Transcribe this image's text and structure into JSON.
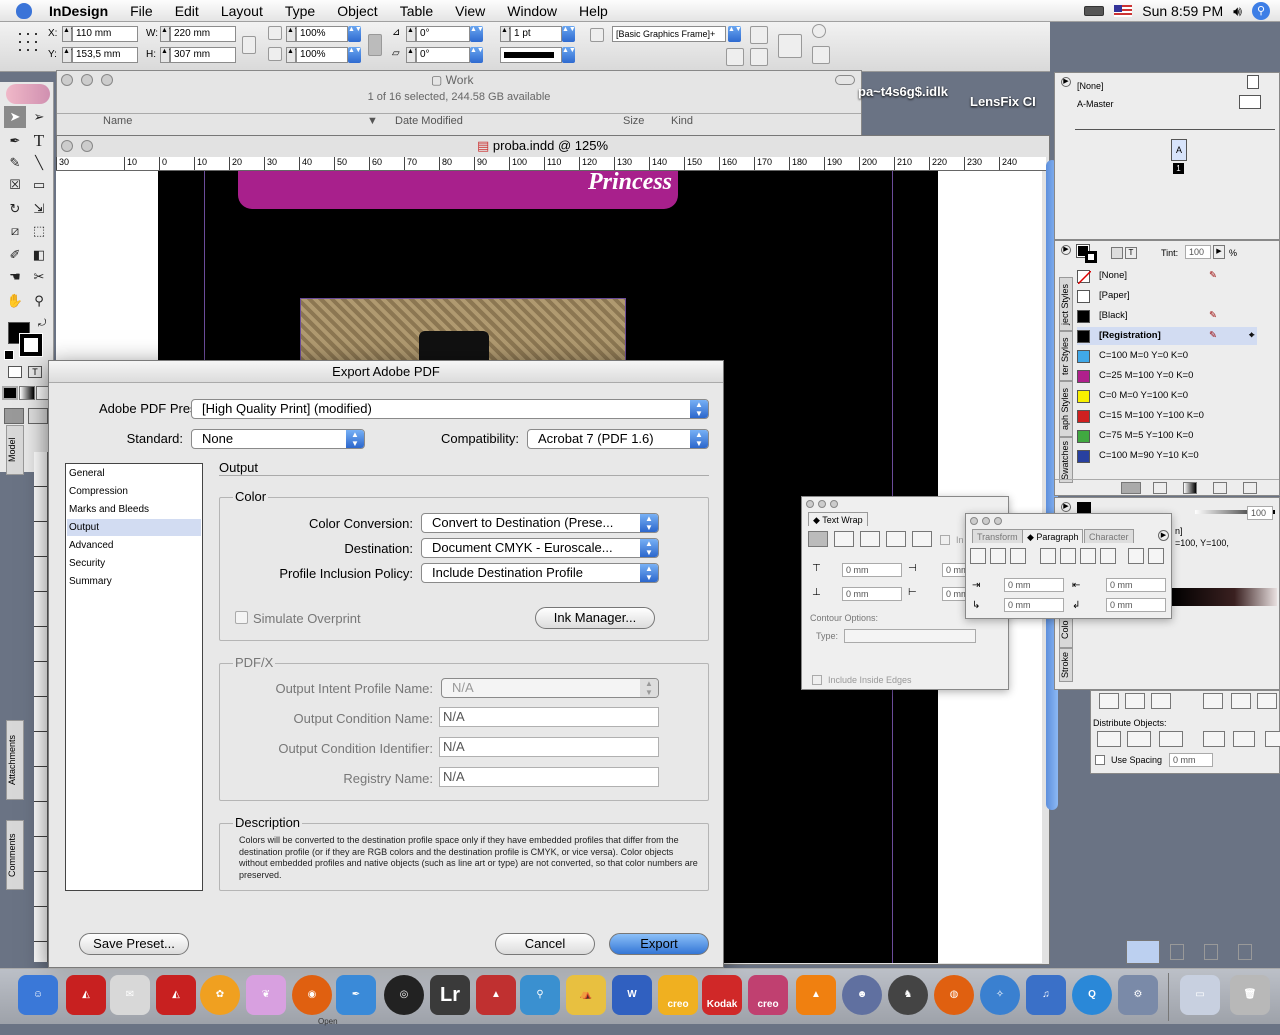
{
  "menubar": {
    "app": "InDesign",
    "items": [
      "File",
      "Edit",
      "Layout",
      "Type",
      "Object",
      "Table",
      "View",
      "Window",
      "Help"
    ],
    "clock": "Sun 8:59 PM"
  },
  "control": {
    "x_label": "X:",
    "x_value": "110 mm",
    "y_label": "Y:",
    "y_value": "153,5 mm",
    "w_label": "W:",
    "w_value": "220 mm",
    "h_label": "H:",
    "h_value": "307 mm",
    "scale_x": "100%",
    "scale_y": "100%",
    "rotate": "0°",
    "shear": "0°",
    "stroke": "1 pt",
    "object_style": "[Basic Graphics Frame]+"
  },
  "finder": {
    "title": "Work",
    "status": "1 of 16 selected, 244.58 GB available",
    "columns": [
      "Name",
      "Date Modified",
      "Size",
      "Kind"
    ]
  },
  "desktop": {
    "item1": "pa~t4s6g$.idlk",
    "item2": "LensFix CI"
  },
  "document": {
    "title": "proba.indd @ 125%",
    "banner_text": "Princess",
    "ruler_ticks": [
      "30",
      "10",
      "0",
      "10",
      "20",
      "30",
      "40",
      "50",
      "60",
      "70",
      "80",
      "90",
      "100",
      "110",
      "120",
      "130",
      "140",
      "150",
      "160",
      "170",
      "180",
      "190",
      "200",
      "210",
      "220",
      "230",
      "240"
    ]
  },
  "pages_panel": {
    "none": "[None]",
    "master": "A-Master",
    "page_letter": "A",
    "page_num": "1"
  },
  "swatches": {
    "tint_label": "Tint:",
    "tint_value": "100",
    "tint_unit": "%",
    "tabs": [
      "Swatches",
      "aph Styles",
      "ter Styles",
      "ject Styles"
    ],
    "items": [
      {
        "name": "[None]",
        "color": "#ffffff"
      },
      {
        "name": "[Paper]",
        "color": "#ffffff"
      },
      {
        "name": "[Black]",
        "color": "#000000"
      },
      {
        "name": "[Registration]",
        "color": "#000000"
      },
      {
        "name": "C=100 M=0 Y=0 K=0",
        "color": "#40a8e8"
      },
      {
        "name": "C=25 M=100 Y=0 K=0",
        "color": "#b0208c"
      },
      {
        "name": "C=0 M=0 Y=100 K=0",
        "color": "#f8f000"
      },
      {
        "name": "C=15 M=100 Y=100 K=0",
        "color": "#d02020"
      },
      {
        "name": "C=75 M=5 Y=100 K=0",
        "color": "#40a840"
      },
      {
        "name": "C=100 M=90 Y=10 K=0",
        "color": "#2840a0"
      }
    ]
  },
  "color_panel": {
    "value": "100",
    "partial": "n]",
    "partial2": "=100, Y=100,",
    "tabs": [
      "Colo",
      "Stroke"
    ]
  },
  "align_panel": {
    "distribute_label": "Distribute Objects:",
    "spacing_label": "Use Spacing",
    "spacing_value": "0 mm"
  },
  "text_wrap": {
    "tab": "Text Wrap",
    "fields": [
      "0 mm",
      "0 mm",
      "0 mm",
      "0 mm"
    ],
    "contour_label": "Contour Options:",
    "type_label": "Type:",
    "inside_label": "Include Inside Edges",
    "partial": "In"
  },
  "paragraph": {
    "tabs": [
      "Transform",
      "Paragraph",
      "Character"
    ],
    "fields": [
      "0 mm",
      "0 mm",
      "0 mm",
      "0 mm"
    ]
  },
  "dialog": {
    "title": "Export Adobe PDF",
    "preset_label": "Adobe PDF Preset:",
    "preset_value": "[High Quality Print] (modified)",
    "standard_label": "Standard:",
    "standard_value": "None",
    "compat_label": "Compatibility:",
    "compat_value": "Acrobat 7 (PDF 1.6)",
    "sections": [
      "General",
      "Compression",
      "Marks and Bleeds",
      "Output",
      "Advanced",
      "Security",
      "Summary"
    ],
    "selected_section": "Output",
    "heading": "Output",
    "color_group": "Color",
    "conv_label": "Color Conversion:",
    "conv_value": "Convert to Destination (Prese...",
    "dest_label": "Destination:",
    "dest_value": "Document CMYK - Euroscale...",
    "policy_label": "Profile Inclusion Policy:",
    "policy_value": "Include Destination Profile",
    "simulate_label": "Simulate Overprint",
    "ink_button": "Ink Manager...",
    "pdfx_group": "PDF/X",
    "intent_label": "Output Intent Profile Name:",
    "intent_value": "N/A",
    "cond_name_label": "Output Condition Name:",
    "cond_name_value": "N/A",
    "cond_id_label": "Output Condition Identifier:",
    "cond_id_value": "N/A",
    "registry_label": "Registry Name:",
    "registry_value": "N/A",
    "desc_group": "Description",
    "desc_text": "Colors will be converted to the destination profile space only if they have embedded profiles that differ from the destination profile (or if they are RGB colors and the destination profile is CMYK, or vice versa). Color objects without embedded profiles and native objects (such as line art or type) are not converted, so that color numbers are preserved.",
    "save_preset": "Save Preset...",
    "cancel": "Cancel",
    "export": "Export"
  },
  "left_tabs": [
    "Model",
    "Attachments",
    "Comments"
  ],
  "dock": {
    "lr_label": "Lr",
    "creo1": "creo",
    "kodak": "Kodak",
    "creo2": "creo",
    "partial_label": "Open"
  }
}
